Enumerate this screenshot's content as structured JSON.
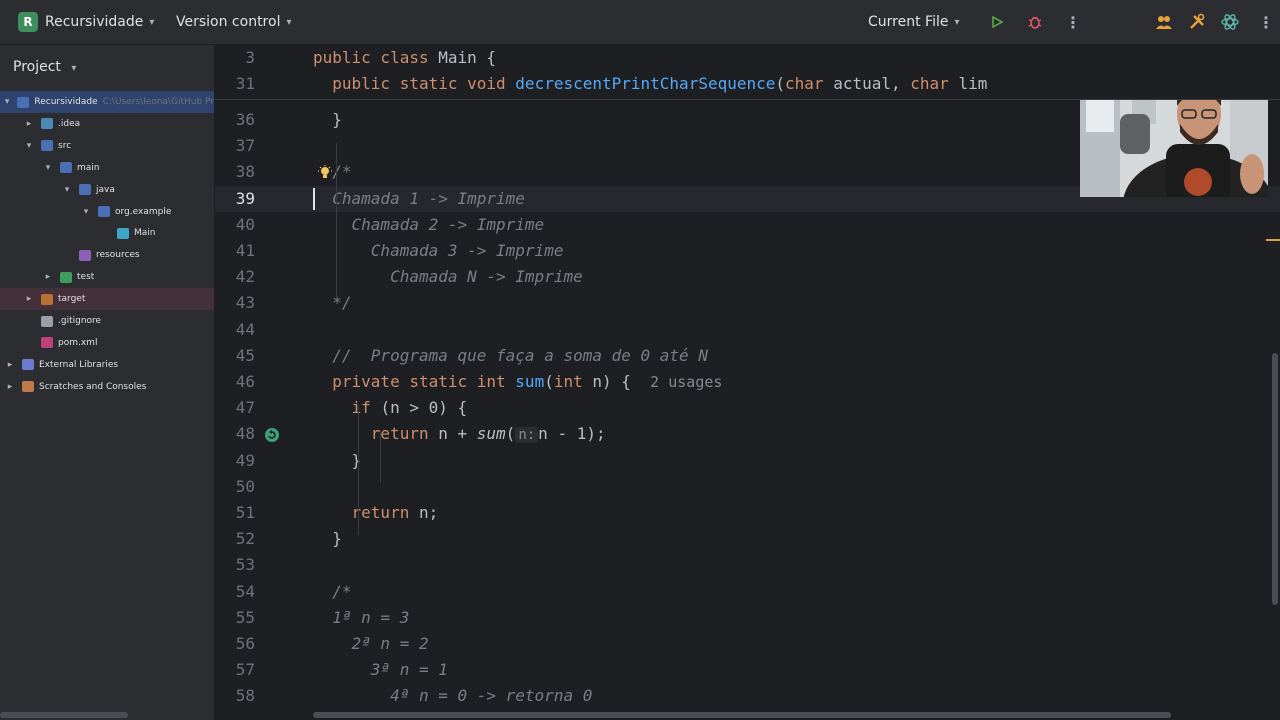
{
  "toolbar": {
    "project_badge": "R",
    "project_name": "Recursividade",
    "vcs_label": "Version control",
    "run_config": "Current File"
  },
  "panel": {
    "title": "Project",
    "tree": [
      {
        "label": "Recursividade",
        "hint": "C:\\Users\\leona\\GitHub Pr",
        "depth": 0,
        "arrow": "▾",
        "icon": "folder-module-icon",
        "color": "#4a6fb5"
      },
      {
        "label": ".idea",
        "depth": 1,
        "arrow": "▸",
        "icon": "folder-icon",
        "color": "#4a8ab5"
      },
      {
        "label": "src",
        "depth": 1,
        "arrow": "▾",
        "icon": "folder-icon",
        "color": "#4a6fb5"
      },
      {
        "label": "main",
        "depth": 2,
        "arrow": "▾",
        "icon": "folder-icon",
        "color": "#4a6fb5"
      },
      {
        "label": "java",
        "depth": 3,
        "arrow": "▾",
        "icon": "folder-source-icon",
        "color": "#4a6fb5"
      },
      {
        "label": "org.example",
        "depth": 4,
        "arrow": "▾",
        "icon": "package-icon",
        "color": "#4a6fb5"
      },
      {
        "label": "Main",
        "depth": 5,
        "arrow": "",
        "icon": "class-icon",
        "color": "#3fa6c8"
      },
      {
        "label": "resources",
        "depth": 3,
        "arrow": "",
        "icon": "folder-resources-icon",
        "color": "#8e5fb8"
      },
      {
        "label": "test",
        "depth": 2,
        "arrow": "▸",
        "icon": "folder-test-icon",
        "color": "#3e9e5e"
      },
      {
        "label": "target",
        "depth": 1,
        "arrow": "▸",
        "icon": "folder-excluded-icon",
        "color": "#b87333"
      },
      {
        "label": ".gitignore",
        "depth": 1,
        "arrow": "",
        "icon": "git-icon",
        "color": "#9aa0a6"
      },
      {
        "label": "pom.xml",
        "depth": 1,
        "arrow": "",
        "icon": "maven-icon",
        "color": "#c2407a"
      },
      {
        "label": "External Libraries",
        "depth": 0,
        "arrow": "▸",
        "icon": "libraries-icon",
        "color": "#6c7bd0"
      },
      {
        "label": "Scratches and Consoles",
        "depth": 0,
        "arrow": "▸",
        "icon": "scratches-icon",
        "color": "#c07a4a"
      }
    ]
  },
  "editor": {
    "sticky": [
      {
        "num": "3",
        "tokens": [
          [
            "kw",
            "public class "
          ],
          [
            "plain",
            "Main {"
          ]
        ]
      },
      {
        "num": "31",
        "tokens": [
          [
            "kw",
            "  public static void "
          ],
          [
            "fn",
            "decrescentPrintCharSequence"
          ],
          [
            "plain",
            "("
          ],
          [
            "kw",
            "char "
          ],
          [
            "plain",
            "actual, "
          ],
          [
            "kw",
            "char "
          ],
          [
            "plain",
            "lim"
          ]
        ]
      }
    ],
    "lines": [
      {
        "num": "36",
        "tokens": [
          [
            "plain",
            "  }"
          ]
        ]
      },
      {
        "num": "37",
        "tokens": []
      },
      {
        "num": "38",
        "tokens": [
          [
            "cm",
            "  /*"
          ]
        ]
      },
      {
        "num": "39",
        "current": true,
        "tokens": [
          [
            "cm",
            "  Chamada 1 -> Imprime"
          ]
        ]
      },
      {
        "num": "40",
        "tokens": [
          [
            "cm",
            "    Chamada 2 -> Imprime"
          ]
        ]
      },
      {
        "num": "41",
        "tokens": [
          [
            "cm",
            "      Chamada 3 -> Imprime"
          ]
        ]
      },
      {
        "num": "42",
        "tokens": [
          [
            "cm",
            "        Chamada N -> Imprime"
          ]
        ]
      },
      {
        "num": "43",
        "tokens": [
          [
            "cm",
            "  */"
          ]
        ]
      },
      {
        "num": "44",
        "tokens": []
      },
      {
        "num": "45",
        "tokens": [
          [
            "cm",
            "  //  Programa que faça a soma de 0 até N"
          ]
        ]
      },
      {
        "num": "46",
        "tokens": [
          [
            "kw",
            "  private static int "
          ],
          [
            "fn",
            "sum"
          ],
          [
            "plain",
            "("
          ],
          [
            "kw",
            "int "
          ],
          [
            "plain",
            "n) {  "
          ],
          [
            "usage",
            "2 usages"
          ]
        ]
      },
      {
        "num": "47",
        "tokens": [
          [
            "kw",
            "    if "
          ],
          [
            "plain",
            "(n > 0) {"
          ]
        ]
      },
      {
        "num": "48",
        "tokens": [
          [
            "kw",
            "      return "
          ],
          [
            "plain",
            "n + "
          ],
          [
            "fnit",
            "sum"
          ],
          [
            "plain",
            "("
          ],
          [
            "hint",
            "n:"
          ],
          [
            "plain",
            "n - 1);"
          ]
        ]
      },
      {
        "num": "49",
        "tokens": [
          [
            "plain",
            "    }"
          ]
        ]
      },
      {
        "num": "50",
        "tokens": []
      },
      {
        "num": "51",
        "tokens": [
          [
            "kw",
            "    return "
          ],
          [
            "plain",
            "n;"
          ]
        ]
      },
      {
        "num": "52",
        "tokens": [
          [
            "plain",
            "  }"
          ]
        ]
      },
      {
        "num": "53",
        "tokens": []
      },
      {
        "num": "54",
        "tokens": [
          [
            "cm",
            "  /*"
          ]
        ]
      },
      {
        "num": "55",
        "tokens": [
          [
            "cm",
            "  1ª n = 3"
          ]
        ]
      },
      {
        "num": "56",
        "tokens": [
          [
            "cm",
            "    2ª n = 2"
          ]
        ]
      },
      {
        "num": "57",
        "tokens": [
          [
            "cm",
            "      3ª n = 1"
          ]
        ]
      },
      {
        "num": "58",
        "tokens": [
          [
            "cm",
            "        4ª n = 0 -> retorna 0"
          ]
        ]
      }
    ]
  },
  "colors": {
    "keyword": "#cf8e6d",
    "function": "#56a8f5",
    "comment": "#7a7e85",
    "text": "#bcbec4",
    "background": "#1e1f22",
    "panel": "#2b2d30"
  }
}
